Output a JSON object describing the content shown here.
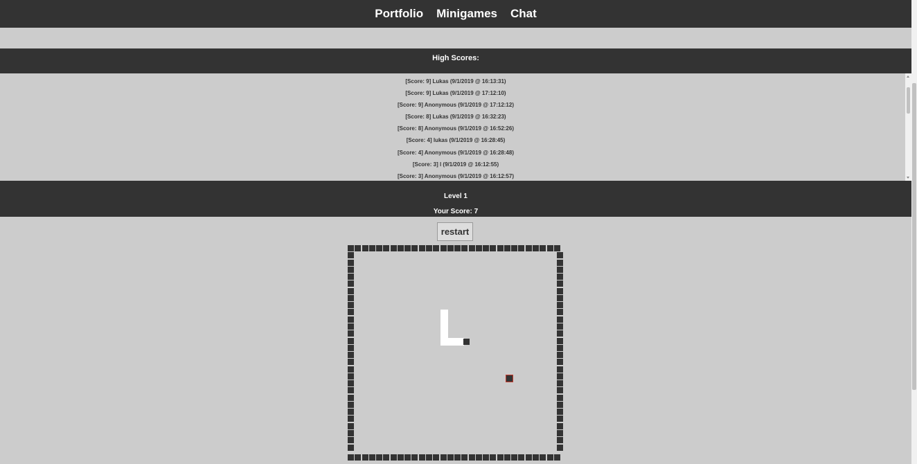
{
  "nav": {
    "portfolio": "Portfolio",
    "minigames": "Minigames",
    "chat": "Chat"
  },
  "high_scores": {
    "title": "High Scores:",
    "entries": [
      "[Score: 9] Lukas (9/1/2019 @ 16:13:31)",
      "[Score: 9] Lukas (9/1/2019 @ 17:12:10)",
      "[Score: 9] Anonymous (9/1/2019 @ 17:12:12)",
      "[Score: 8] Lukas (9/1/2019 @ 16:32:23)",
      "[Score: 8] Anonymous (9/1/2019 @ 16:52:26)",
      "[Score: 4] lukas (9/1/2019 @ 16:28:45)",
      "[Score: 4] Anonymous (9/1/2019 @ 16:28:48)",
      "[Score: 3] l (9/1/2019 @ 16:12:55)",
      "[Score: 3] Anonymous (9/1/2019 @ 16:12:57)"
    ]
  },
  "game": {
    "level": "Level 1",
    "score": "Your Score: 7",
    "restart_label": "restart"
  },
  "colors": {
    "dark": "#333333",
    "background": "#cccccc",
    "snake": "#ffffff",
    "food_border": "#c0392b"
  }
}
